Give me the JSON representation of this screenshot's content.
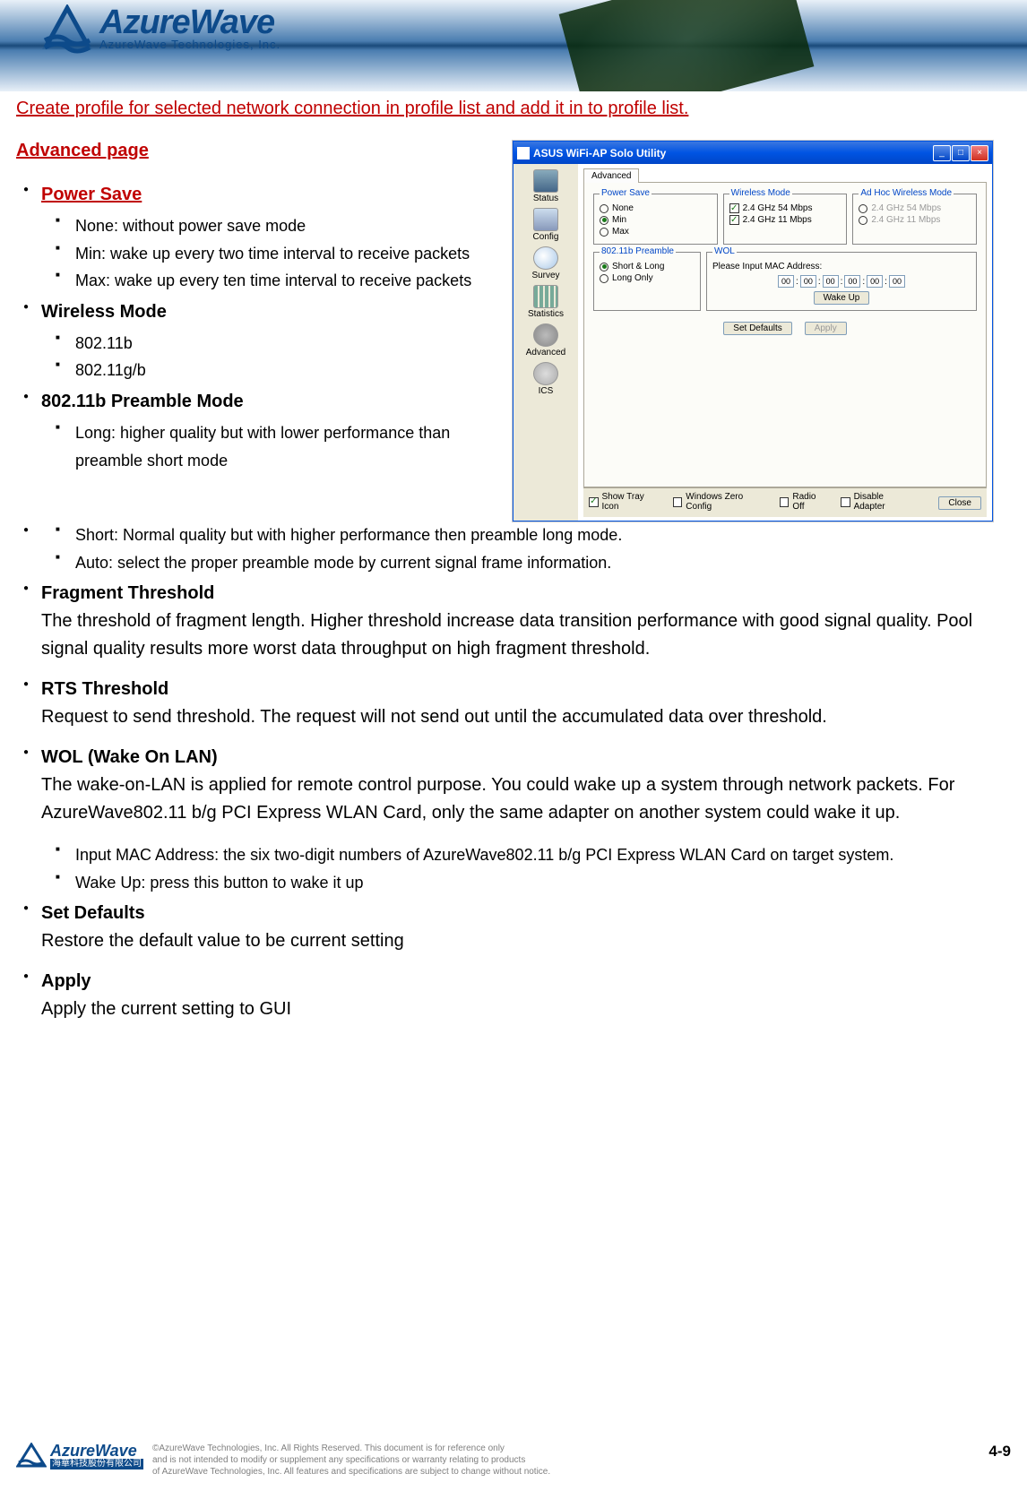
{
  "header": {
    "logo_main": "AzureWave",
    "logo_sub": "AzureWave  Technologies,  Inc."
  },
  "intro": "Create profile for selected network connection in profile list and add it in to profile list.",
  "adv_heading": "Advanced page",
  "sections": {
    "power_save": {
      "title": "Power Save",
      "items": [
        "None: without power save mode",
        "Min: wake up every two time interval to receive packets",
        "Max: wake up every ten time interval to receive packets"
      ]
    },
    "wireless_mode": {
      "title": "Wireless Mode",
      "items": [
        "802.11b",
        "802.11g/b"
      ]
    },
    "preamble": {
      "title": "802.11b Preamble Mode",
      "items": [
        "Long: higher quality but with lower performance than preamble short mode",
        "Short: Normal quality but with higher performance then preamble long mode.",
        "Auto: select the proper preamble mode by current signal frame information."
      ]
    },
    "fragment": {
      "title": "Fragment Threshold",
      "desc": "The threshold of fragment length. Higher threshold increase data transition performance with good signal quality. Pool signal quality results more worst data throughput on high fragment threshold."
    },
    "rts": {
      "title": "RTS Threshold",
      "desc": "Request to send threshold. The request will not send out until the accumulated data over threshold."
    },
    "wol": {
      "title": "WOL (Wake On LAN)",
      "desc": "The wake-on-LAN is applied for remote control purpose. You could wake up a system through network packets. For AzureWave802.11 b/g PCI Express WLAN Card, only the same adapter on another system could wake it up.",
      "items": [
        "Input MAC Address: the six two-digit numbers of AzureWave802.11 b/g PCI Express WLAN Card on target system.",
        "Wake Up: press this button to wake it up"
      ]
    },
    "set_defaults": {
      "title": "Set Defaults",
      "desc": "Restore the default value to be current setting"
    },
    "apply": {
      "title": "Apply",
      "desc": "Apply the current setting to GUI"
    }
  },
  "dialog": {
    "title": "ASUS WiFi-AP Solo Utility",
    "sidebar": [
      "Status",
      "Config",
      "Survey",
      "Statistics",
      "Advanced",
      "ICS"
    ],
    "tab": "Advanced",
    "groups": {
      "power_save": {
        "title": "Power Save",
        "options": [
          "None",
          "Min",
          "Max"
        ],
        "selected": "Min"
      },
      "wireless_mode": {
        "title": "Wireless Mode",
        "options": [
          "2.4 GHz 54 Mbps",
          "2.4 GHz 11 Mbps"
        ]
      },
      "adhoc": {
        "title": "Ad Hoc Wireless Mode",
        "options": [
          "2.4 GHz 54 Mbps",
          "2.4 GHz 11 Mbps"
        ]
      },
      "preamble": {
        "title": "802.11b Preamble",
        "options": [
          "Short & Long",
          "Long Only"
        ],
        "selected": "Short & Long"
      },
      "wol": {
        "title": "WOL",
        "label": "Please Input MAC Address:",
        "mac": [
          "00",
          "00",
          "00",
          "00",
          "00",
          "00"
        ],
        "wake_btn": "Wake Up"
      }
    },
    "buttons": {
      "defaults": "Set Defaults",
      "apply": "Apply"
    },
    "bottom": {
      "show_tray": "Show Tray Icon",
      "zero_config": "Windows Zero Config",
      "radio_off": "Radio Off",
      "disable_adapter": "Disable Adapter",
      "close": "Close"
    }
  },
  "footer": {
    "logo_main": "AzureWave",
    "logo_sub": "海華科技股份有限公司",
    "copyright1": "©AzureWave Technologies, Inc. All Rights Reserved. This document is for reference only",
    "copyright2": "and is not intended to modify or supplement any specifications or warranty relating to products",
    "copyright3": "of AzureWave Technologies, Inc.  All features and specifications are subject to change without notice.",
    "page": "4-9"
  }
}
